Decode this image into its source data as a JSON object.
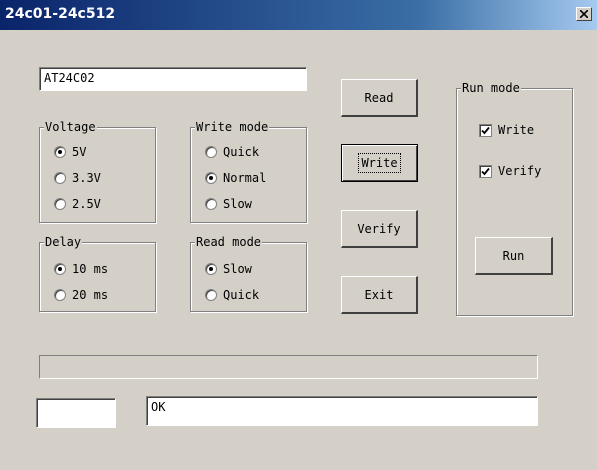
{
  "window": {
    "title": "24c01-24c512"
  },
  "chip_field": {
    "value": "AT24C02"
  },
  "voltage": {
    "label": "Voltage",
    "options": [
      {
        "label": "5V",
        "selected": true
      },
      {
        "label": "3.3V",
        "selected": false
      },
      {
        "label": "2.5V",
        "selected": false
      }
    ]
  },
  "write_mode": {
    "label": "Write mode",
    "options": [
      {
        "label": "Quick",
        "selected": false
      },
      {
        "label": "Normal",
        "selected": true
      },
      {
        "label": "Slow",
        "selected": false
      }
    ]
  },
  "delay": {
    "label": "Delay",
    "options": [
      {
        "label": "10 ms",
        "selected": true
      },
      {
        "label": "20 ms",
        "selected": false
      }
    ]
  },
  "read_mode": {
    "label": "Read mode",
    "options": [
      {
        "label": "Slow",
        "selected": true
      },
      {
        "label": "Quick",
        "selected": false
      }
    ]
  },
  "buttons": {
    "read": "Read",
    "write": "Write",
    "verify": "Verify",
    "exit": "Exit"
  },
  "run_mode": {
    "label": "Run mode",
    "write_label": "Write",
    "write_checked": true,
    "verify_label": "Verify",
    "verify_checked": true,
    "run_button": "Run"
  },
  "progress": {
    "value": 0
  },
  "status": {
    "left_value": "",
    "message": "OK"
  }
}
